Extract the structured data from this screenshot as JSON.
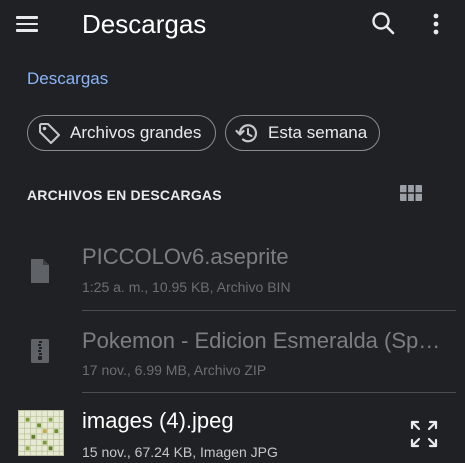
{
  "app_bar": {
    "title": "Descargas",
    "icons": {
      "menu": "menu-icon",
      "search": "search-icon",
      "more": "more-vert-icon"
    }
  },
  "breadcrumb": {
    "label": "Descargas"
  },
  "filters": [
    {
      "label": "Archivos grandes",
      "icon": "tag-icon"
    },
    {
      "label": "Esta semana",
      "icon": "history-icon"
    }
  ],
  "section": {
    "title": "ARCHIVOS EN DESCARGAS",
    "view_icon": "grid-view-icon"
  },
  "files": [
    {
      "name": "PICCOLOv6.aseprite",
      "meta": "1:25 a. m., 10.95 KB, Archivo BIN",
      "icon": "file-icon"
    },
    {
      "name": "Pokemon - Edicion Esmeralda (Spain).zip",
      "meta": "17 nov., 6.99 MB, Archivo ZIP",
      "icon": "zip-file-icon"
    },
    {
      "name": "images (4).jpeg",
      "meta": "15 nov., 67.24 KB, Imagen JPG",
      "icon": "image-thumbnail"
    }
  ],
  "colors": {
    "background": "#202124",
    "accent": "#8ab4f8",
    "text_primary": "#ffffff",
    "text_dimmed": "#7b7e82",
    "chip_border": "#8a8d91"
  }
}
